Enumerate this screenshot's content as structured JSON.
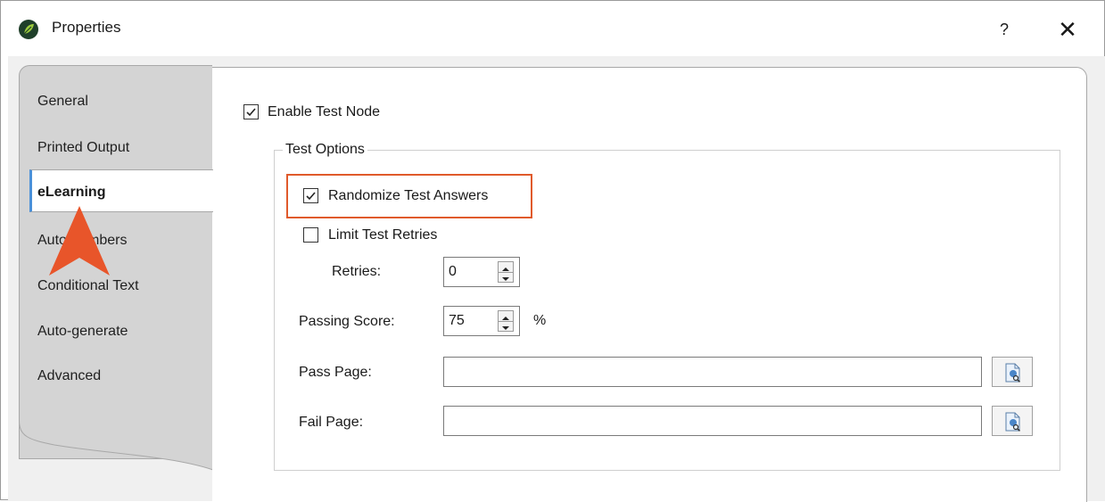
{
  "window": {
    "title": "Properties",
    "help_label": "?",
    "close_label": "✕"
  },
  "tabs": [
    {
      "label": "General"
    },
    {
      "label": "Printed Output"
    },
    {
      "label": "eLearning",
      "active": true
    },
    {
      "label": "Auto-numbers"
    },
    {
      "label": "Conditional Text"
    },
    {
      "label": "Auto-generate"
    },
    {
      "label": "Advanced"
    }
  ],
  "content": {
    "enable_test_node": {
      "label": "Enable Test Node",
      "checked": true
    },
    "test_options": {
      "title": "Test Options",
      "randomize": {
        "label": "Randomize Test Answers",
        "checked": true
      },
      "limit_retries": {
        "label": "Limit Test Retries",
        "checked": false
      },
      "retries": {
        "label": "Retries:",
        "value": "0"
      },
      "passing_score": {
        "label": "Passing Score:",
        "value": "75",
        "unit": "%"
      },
      "pass_page": {
        "label": "Pass Page:",
        "value": ""
      },
      "fail_page": {
        "label": "Fail Page:",
        "value": ""
      }
    }
  },
  "icons": {
    "app": "flare-leaf-icon",
    "browse": "browse-file-icon",
    "pointer": "orange-arrow-pointer-icon"
  },
  "colors": {
    "highlight": "#e05a2b",
    "active_tab_accent": "#4a90d9",
    "pointer": "#e8552a"
  }
}
